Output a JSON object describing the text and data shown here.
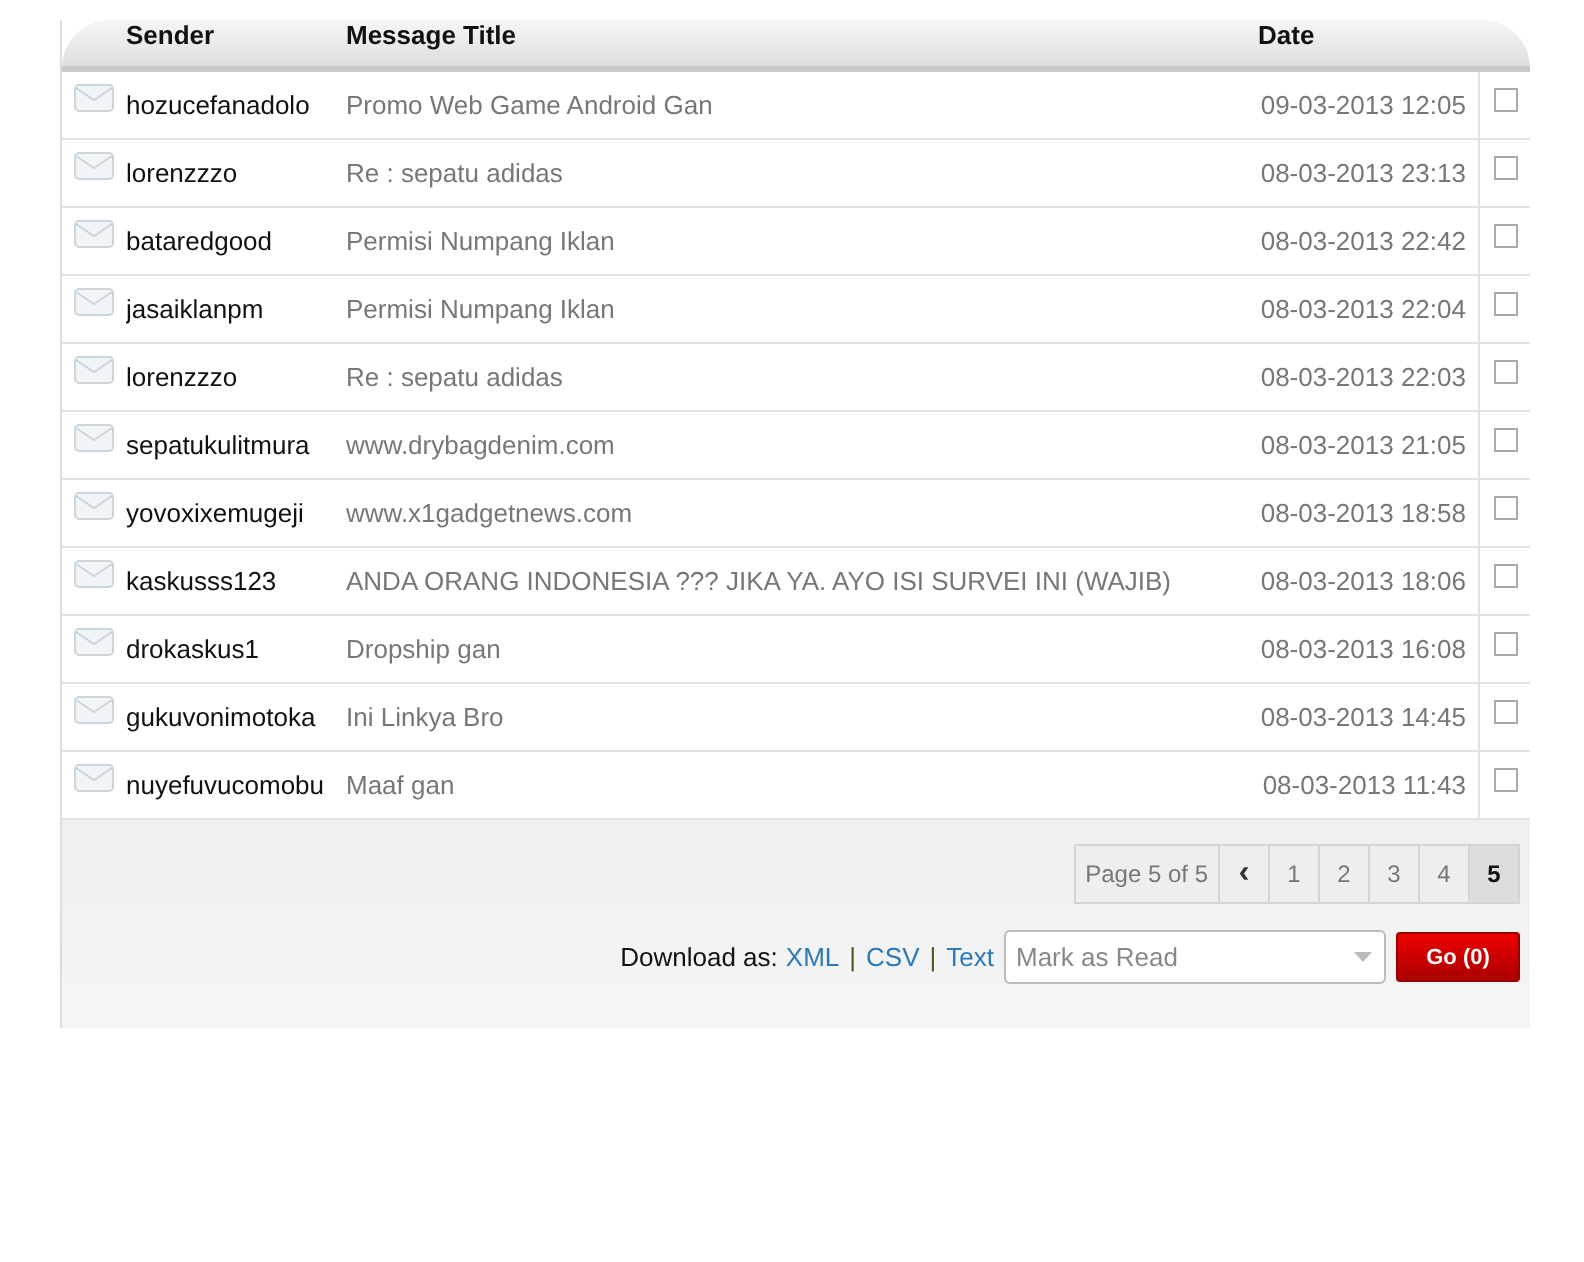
{
  "table": {
    "columns": [
      "Sender",
      "Message Title",
      "Date"
    ],
    "rows": [
      {
        "sender": "hozucefanadolo",
        "title": "Promo Web Game Android Gan",
        "date": "09-03-2013 12:05",
        "checked": false
      },
      {
        "sender": "lorenzzzo",
        "title": "Re : sepatu adidas",
        "date": "08-03-2013 23:13",
        "checked": false
      },
      {
        "sender": "bataredgood",
        "title": "Permisi Numpang Iklan",
        "date": "08-03-2013 22:42",
        "checked": false
      },
      {
        "sender": "jasaiklanpm",
        "title": "Permisi Numpang Iklan",
        "date": "08-03-2013 22:04",
        "checked": false
      },
      {
        "sender": "lorenzzzo",
        "title": "Re : sepatu adidas",
        "date": "08-03-2013 22:03",
        "checked": false
      },
      {
        "sender": "sepatukulitmura",
        "title": "www.drybagdenim.com",
        "date": "08-03-2013 21:05",
        "checked": false
      },
      {
        "sender": "yovoxixemugeji",
        "title": "www.x1gadgetnews.com",
        "date": "08-03-2013 18:58",
        "checked": false
      },
      {
        "sender": "kaskusss123",
        "title": "ANDA ORANG INDONESIA ??? JIKA YA. AYO ISI SURVEI INI (WAJIB)",
        "date": "08-03-2013 18:06",
        "checked": false
      },
      {
        "sender": "drokaskus1",
        "title": "Dropship gan",
        "date": "08-03-2013 16:08",
        "checked": false
      },
      {
        "sender": "gukuvonimotoka",
        "title": "Ini Linkya Bro",
        "date": "08-03-2013 14:45",
        "checked": false
      },
      {
        "sender": "nuyefuvucomobu",
        "title": "Maaf gan",
        "date": "08-03-2013 11:43",
        "checked": false
      }
    ]
  },
  "pagination": {
    "label": "Page 5 of 5",
    "prev": "‹",
    "pages": [
      {
        "label": "1",
        "selected": false
      },
      {
        "label": "2",
        "selected": false
      },
      {
        "label": "3",
        "selected": false
      },
      {
        "label": "4",
        "selected": false
      },
      {
        "label": "5",
        "selected": true
      }
    ]
  },
  "download": {
    "label": "Download as:",
    "links": [
      "XML",
      "CSV",
      "Text"
    ],
    "separators": [
      "|",
      "|"
    ]
  },
  "action_select": {
    "value": "Mark as Read"
  },
  "go_button": "Go (0)"
}
